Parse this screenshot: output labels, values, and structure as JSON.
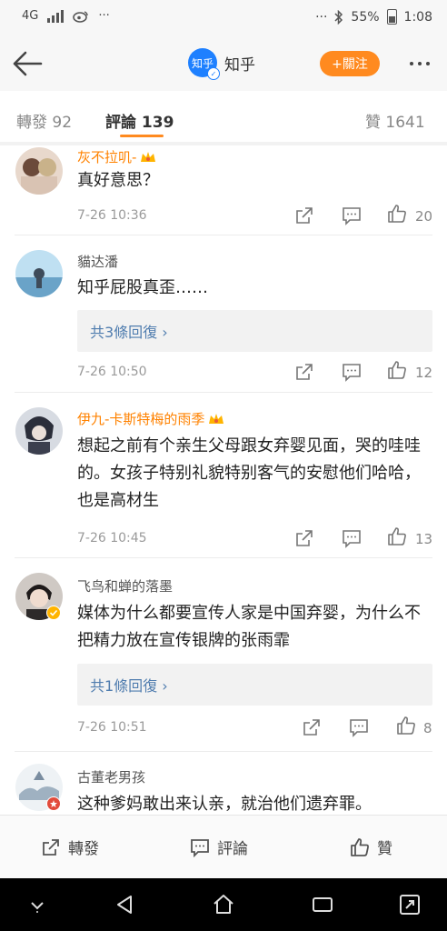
{
  "status": {
    "network": "4G",
    "battery": "55%",
    "time": "1:08",
    "dots": "···"
  },
  "nav": {
    "title": "知乎",
    "logo_text": "知乎",
    "follow_label": "+關注"
  },
  "tabs": [
    {
      "label": "轉發",
      "count": "92"
    },
    {
      "label": "評論",
      "count": "139"
    },
    {
      "label": "贊",
      "count": "1641"
    }
  ],
  "comments": [
    {
      "user": "灰不拉叽-",
      "text": "真好意思？",
      "time": "7-26 10:36",
      "likes": "20",
      "replies": ""
    },
    {
      "user": "貓达潘",
      "text": "知乎屁股真歪……",
      "time": "7-26 10:50",
      "likes": "12",
      "replies": "共3條回復 ›"
    },
    {
      "user": "伊九-卡斯特梅的雨季",
      "text": "想起之前有个亲生父母跟女弃婴见面，哭的哇哇的。女孩子特别礼貌特别客气的安慰他们哈哈，也是高材生",
      "time": "7-26 10:45",
      "likes": "13",
      "replies": ""
    },
    {
      "user": "飞鸟和蝉的落墨",
      "text": "媒体为什么都要宣传人家是中国弃婴，为什么不把精力放在宣传银牌的张雨霏",
      "time": "7-26 10:51",
      "likes": "8",
      "replies": "共1條回復 ›"
    },
    {
      "user": "古董老男孩",
      "text": "这种爹妈敢出来认亲，就治他们遗弃罪。",
      "time": "",
      "likes": "",
      "replies": ""
    }
  ],
  "bottom": {
    "repost": "轉發",
    "comment": "評論",
    "like": "贊"
  },
  "colors": {
    "accent": "#ff8a1f",
    "link": "#507daf",
    "vip_name": "#ff8200",
    "brand_blue": "#1e80ff"
  }
}
